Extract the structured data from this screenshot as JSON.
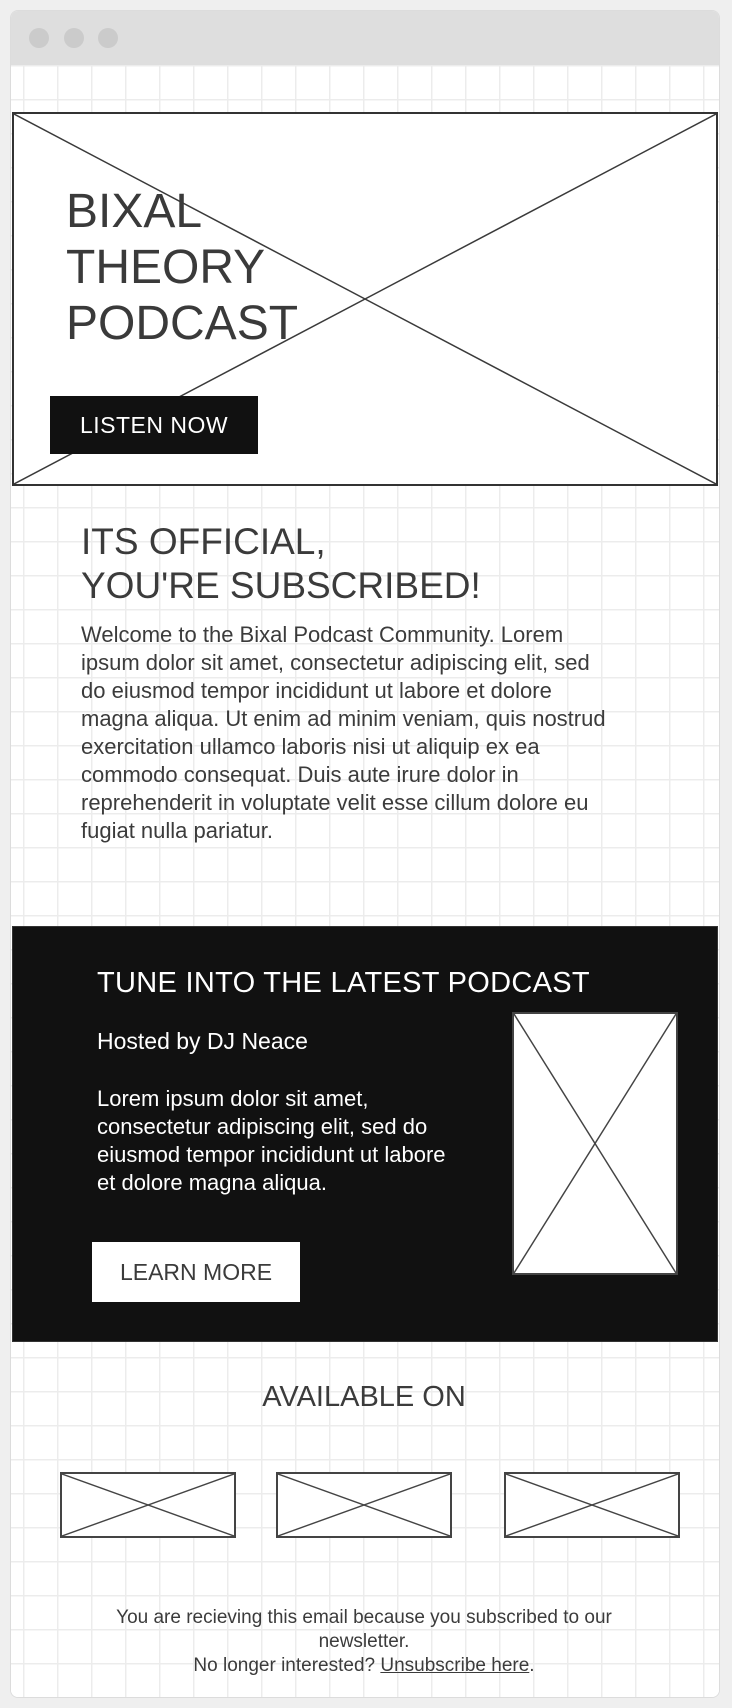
{
  "hero": {
    "title_lines": [
      "BIXAL",
      "THEORY",
      "PODCAST"
    ],
    "button_label": "LISTEN NOW"
  },
  "subscribed": {
    "title_lines": [
      "ITS OFFICIAL,",
      "YOU'RE SUBSCRIBED!"
    ],
    "body": "Welcome to the Bixal Podcast Community. Lorem ipsum dolor sit amet, consectetur adipiscing elit, sed do eiusmod tempor incididunt ut labore et dolore magna aliqua. Ut enim ad minim veniam, quis nostrud exercitation ullamco laboris nisi ut aliquip ex ea commodo consequat. Duis aute irure dolor in reprehenderit in voluptate velit esse cillum dolore eu fugiat nulla pariatur."
  },
  "latest": {
    "title": "TUNE INTO THE LATEST PODCAST",
    "host": "Hosted by DJ Neace",
    "body": "Lorem ipsum dolor sit amet, consectetur adipiscing elit, sed do eiusmod tempor incididunt ut labore et dolore magna aliqua.",
    "button_label": "LEARN MORE"
  },
  "available": {
    "title": "AVAILABLE ON"
  },
  "footer": {
    "line1": "You are recieving this email because you subscribed to our newsletter.",
    "prefix": "No longer interested?",
    "link": "Unsubscribe here",
    "suffix": "."
  },
  "colors": {
    "dark": "#111111",
    "text": "#3b3b3b",
    "chrome": "#dedede",
    "grid": "#ececec"
  }
}
